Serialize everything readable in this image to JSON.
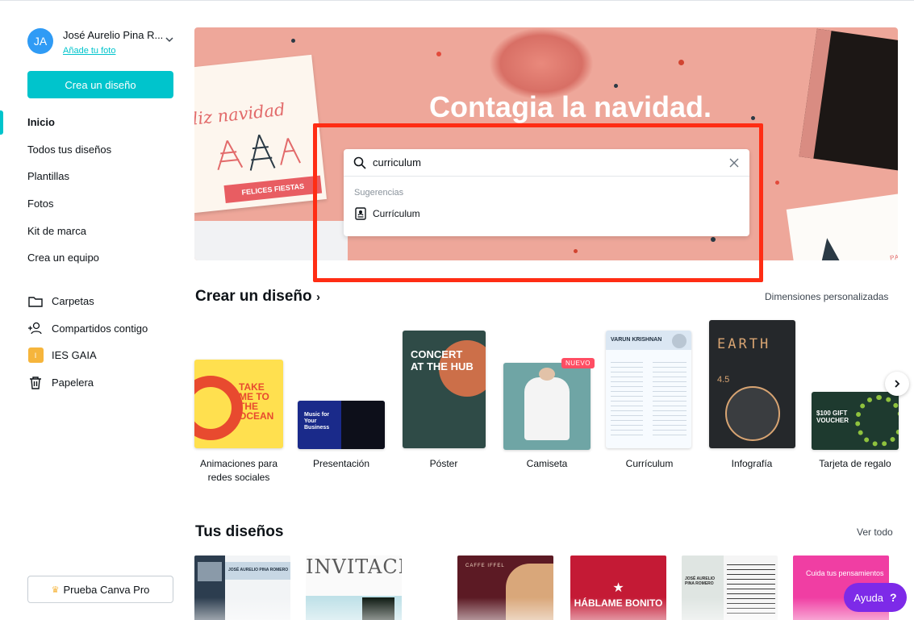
{
  "user": {
    "initials": "JA",
    "name": "José Aurelio Pina R...",
    "add_photo": "Añade tu foto"
  },
  "sidebar": {
    "create_button": "Crea un diseño",
    "nav": [
      {
        "label": "Inicio",
        "active": true
      },
      {
        "label": "Todos tus diseños"
      },
      {
        "label": "Plantillas"
      },
      {
        "label": "Fotos"
      },
      {
        "label": "Kit de marca"
      },
      {
        "label": "Crea un equipo"
      }
    ],
    "folders": [
      {
        "label": "Carpetas",
        "icon": "folder-icon"
      },
      {
        "label": "Compartidos contigo",
        "icon": "shared-users-icon"
      },
      {
        "label": "IES GAIA",
        "icon": "team-badge",
        "badge": "I"
      },
      {
        "label": "Papelera",
        "icon": "trash-icon"
      }
    ],
    "pro_button": "Prueba Canva Pro"
  },
  "hero": {
    "title": "Contagia la navidad.",
    "card_script": "liz navidad",
    "card_ribbon": "FELICES FIESTAS",
    "card_right_text": "PARA"
  },
  "search": {
    "value": "curriculum",
    "suggestions_header": "Sugerencias",
    "suggestions": [
      "Currículum"
    ]
  },
  "create_section": {
    "title": "Crear un diseño",
    "title_arrow": "›",
    "custom_link": "Dimensiones personalizadas",
    "new_badge": "NUEVO",
    "types": [
      {
        "label": "Animaciones para redes sociales",
        "thumb_text": "TAKE ME TO THE OCEAN"
      },
      {
        "label": "Presentación",
        "thumb_text": "Music for Your Business"
      },
      {
        "label": "Póster",
        "thumb_text": "CONCERT AT THE HUB"
      },
      {
        "label": "Camiseta",
        "thumb_text": ""
      },
      {
        "label": "Currículum",
        "thumb_text": "VARUN KRISHNAN"
      },
      {
        "label": "Infografía",
        "thumb_text": "EARTH"
      },
      {
        "label": "Tarjeta de regalo",
        "thumb_text": "$100 GIFT VOUCHER"
      }
    ]
  },
  "designs_section": {
    "title": "Tus diseños",
    "see_all": "Ver todo",
    "items": [
      {
        "text": "JOSÉ AURELIO PINA ROMERO"
      },
      {
        "text": "INVITACIÓ"
      },
      {
        "text": "CAFFE IFFEL"
      },
      {
        "text": "HÁBLAME BONITO"
      },
      {
        "text": "JOSÉ AURELIO PINA ROMERO"
      },
      {
        "text": "Cuida tus pensamientos"
      }
    ]
  },
  "help": {
    "label": "Ayuda",
    "icon_text": "?"
  },
  "colors": {
    "accent": "#00c4cc",
    "highlight": "#ff2d14",
    "help": "#7d2ae8",
    "badge": "#ff4d63"
  }
}
